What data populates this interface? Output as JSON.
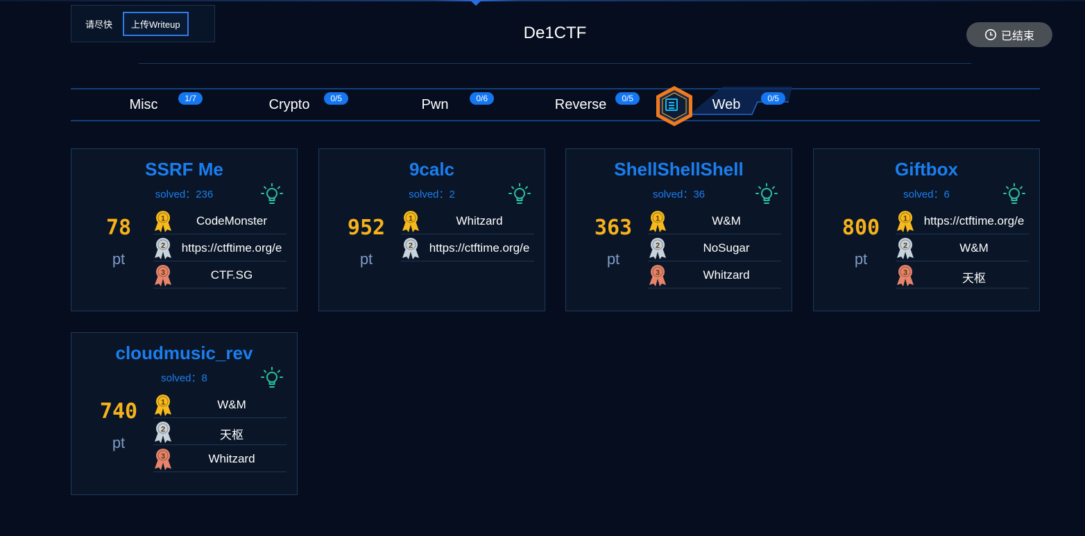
{
  "header": {
    "writeup_prompt": "请尽快",
    "writeup_button": "上传Writeup",
    "title": "De1CTF",
    "status": "已结束"
  },
  "tabs": [
    {
      "label": "Misc",
      "count": "1/7"
    },
    {
      "label": "Crypto",
      "count": "0/5"
    },
    {
      "label": "Pwn",
      "count": "0/6"
    },
    {
      "label": "Reverse",
      "count": "0/5"
    },
    {
      "label": "Web",
      "count": "0/5",
      "active": true
    }
  ],
  "unit": "pt",
  "challenges": [
    {
      "title": "SSRF Me",
      "solved": "solved：236",
      "points": "78",
      "ranks": [
        "CodeMonster",
        "https://ctftime.org/e",
        "CTF.SG"
      ]
    },
    {
      "title": "9calc",
      "solved": "solved：2",
      "points": "952",
      "ranks": [
        "Whitzard",
        "https://ctftime.org/e"
      ]
    },
    {
      "title": "ShellShellShell",
      "solved": "solved：36",
      "points": "363",
      "ranks": [
        "W&M",
        "NoSugar",
        "Whitzard"
      ]
    },
    {
      "title": "Giftbox",
      "solved": "solved：6",
      "points": "800",
      "ranks": [
        "https://ctftime.org/e",
        "W&M",
        "天枢"
      ]
    },
    {
      "title": "cloudmusic_rev",
      "solved": "solved：8",
      "points": "740",
      "ranks": [
        "W&M",
        "天枢",
        "Whitzard"
      ]
    }
  ],
  "colors": {
    "accent": "#1b7ef0",
    "points": "#f7b21c",
    "gold": "#f7b91c",
    "silver": "#c9d3dc",
    "bronze": "#e8846a",
    "hint": "#2fc1a0"
  }
}
